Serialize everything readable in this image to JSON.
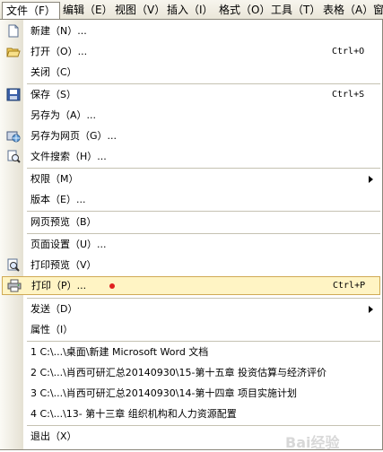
{
  "menubar": {
    "file": "文件（F）",
    "edit": "编辑（E）",
    "view": "视图（V）",
    "insert": "插入（I）",
    "format": "格式（O）",
    "tools": "工具（T）",
    "table": "表格（A）",
    "window": "窗"
  },
  "menu": {
    "new": "新建（N）...",
    "open": "打开（O）...",
    "open_shortcut": "Ctrl+O",
    "close": "关闭（C）",
    "save": "保存（S）",
    "save_shortcut": "Ctrl+S",
    "save_as": "另存为（A）...",
    "save_as_web": "另存为网页（G）...",
    "file_search": "文件搜索（H）...",
    "permission": "权限（M）",
    "versions": "版本（E）...",
    "web_preview": "网页预览（B）",
    "page_setup": "页面设置（U）...",
    "print_preview": "打印预览（V）",
    "print": "打印（P）...",
    "print_shortcut": "Ctrl+P",
    "send_to": "发送（D）",
    "properties": "属性（I）",
    "recent_1": "1 C:\\...\\桌面\\新建 Microsoft Word 文档",
    "recent_2": "2 C:\\...\\肖西可研汇总20140930\\15-第十五章 投资估算与经济评价",
    "recent_3": "3 C:\\...\\肖西可研汇总20140930\\14-第十四章 项目实施计划",
    "recent_4": "4 C:\\...\\13- 第十三章 组织机构和人力资源配置",
    "exit": "退出（X）"
  },
  "watermark": "Bai经验",
  "colors": {
    "menubar_bg": "#ece9d8",
    "gutter": "#e5e1d3",
    "highlight_bg": "#fff4c4",
    "highlight_border": "#d0aa55",
    "red_dot": "#e02020"
  }
}
